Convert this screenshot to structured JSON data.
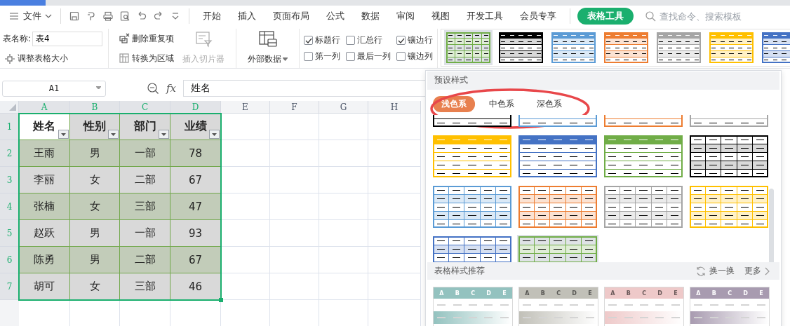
{
  "menu": {
    "file": "文件",
    "tabs": [
      {
        "label": "开始",
        "selected": false
      },
      {
        "label": "插入",
        "selected": false
      },
      {
        "label": "页面布局",
        "selected": false
      },
      {
        "label": "公式",
        "selected": false
      },
      {
        "label": "数据",
        "selected": false
      },
      {
        "label": "审阅",
        "selected": false
      },
      {
        "label": "视图",
        "selected": false
      },
      {
        "label": "开发工具",
        "selected": false
      },
      {
        "label": "会员专享",
        "selected": false
      },
      {
        "label": "表格工具",
        "selected": true
      }
    ],
    "search": {
      "placeholder": "查找命令、搜索模板"
    }
  },
  "ribbon": {
    "table_name": {
      "label": "表名称:",
      "value": "表4"
    },
    "resize": "调整表格大小",
    "tools": [
      {
        "label": "删除重复项",
        "disabled": false
      },
      {
        "label": "转换为区域",
        "disabled": false
      }
    ],
    "slicer": {
      "label": "插入切片器",
      "disabled": true
    },
    "external": "外部数据",
    "options": [
      {
        "label": "标题行",
        "checked": true
      },
      {
        "label": "汇总行",
        "checked": false
      },
      {
        "label": "镶边行",
        "checked": true
      },
      {
        "label": "第一列",
        "checked": false
      },
      {
        "label": "最后一列",
        "checked": false
      },
      {
        "label": "镶边列",
        "checked": false
      }
    ],
    "gallery": [
      {
        "kind": "grid",
        "color": "#70ad47",
        "selected": true
      },
      {
        "kind": "header_banded",
        "color": "#000000",
        "selected": false
      },
      {
        "kind": "header_banded",
        "color": "#5b9bd5",
        "selected": false
      },
      {
        "kind": "header_banded",
        "color": "#ed7d31",
        "selected": false
      },
      {
        "kind": "header_banded",
        "color": "#a5a5a5",
        "selected": false
      },
      {
        "kind": "header_banded",
        "color": "#ffc000",
        "selected": false
      },
      {
        "kind": "header_banded",
        "color": "#4472c4",
        "selected": false
      }
    ]
  },
  "formula_bar": {
    "cell": "A1",
    "fx_label": "fx",
    "value": "姓名"
  },
  "sheet": {
    "columns": [
      {
        "label": "A",
        "selected": true
      },
      {
        "label": "B",
        "selected": true
      },
      {
        "label": "C",
        "selected": true
      },
      {
        "label": "D",
        "selected": true
      },
      {
        "label": "E",
        "selected": false
      },
      {
        "label": "F",
        "selected": false
      },
      {
        "label": "G",
        "selected": false
      },
      {
        "label": "H",
        "selected": false
      }
    ],
    "header": {
      "number": "1",
      "cells": [
        {
          "text": "姓名",
          "active": true
        },
        {
          "text": "性别",
          "active": false
        },
        {
          "text": "部门",
          "active": false
        },
        {
          "text": "业绩",
          "active": false
        }
      ]
    },
    "rows": [
      {
        "number": "2",
        "cells": [
          "王雨",
          "男",
          "一部",
          "78"
        ]
      },
      {
        "number": "3",
        "cells": [
          "李丽",
          "女",
          "二部",
          "67"
        ]
      },
      {
        "number": "4",
        "cells": [
          "张楠",
          "女",
          "三部",
          "47"
        ]
      },
      {
        "number": "5",
        "cells": [
          "赵跃",
          "男",
          "一部",
          "93"
        ]
      },
      {
        "number": "6",
        "cells": [
          "陈勇",
          "男",
          "二部",
          "67"
        ]
      },
      {
        "number": "7",
        "cells": [
          "胡可",
          "女",
          "三部",
          "46"
        ]
      }
    ]
  },
  "panel": {
    "title": "预设样式",
    "categories": [
      {
        "label": "浅色系",
        "selected": true
      },
      {
        "label": "中色系",
        "selected": false
      },
      {
        "label": "深色系",
        "selected": false
      }
    ],
    "presets": [
      {
        "kind": "header",
        "color": "#000000",
        "selected": false
      },
      {
        "kind": "header",
        "color": "#5b9bd5",
        "selected": false
      },
      {
        "kind": "header",
        "color": "#ed7d31",
        "selected": false
      },
      {
        "kind": "header",
        "color": "#a5a5a5",
        "selected": false
      },
      {
        "kind": "header",
        "color": "#ffc000",
        "selected": false
      },
      {
        "kind": "header",
        "color": "#4472c4",
        "selected": false
      },
      {
        "kind": "header",
        "color": "#70ad47",
        "selected": false
      },
      {
        "kind": "grid",
        "color": "#000000",
        "selected": false
      },
      {
        "kind": "grid",
        "color": "#5b9bd5",
        "selected": false
      },
      {
        "kind": "grid",
        "color": "#ed7d31",
        "selected": false
      },
      {
        "kind": "grid",
        "color": "#a5a5a5",
        "selected": false
      },
      {
        "kind": "grid",
        "color": "#ffc000",
        "selected": false
      },
      {
        "kind": "grid",
        "color": "#4472c4",
        "selected": false
      },
      {
        "kind": "grid",
        "color": "#70ad47",
        "selected": true
      }
    ],
    "recommend": {
      "title": "表格样式推荐",
      "refresh": "换一换",
      "more": "更多",
      "items": [
        {
          "color": "#93c2bf",
          "columns": [
            "A",
            "B",
            "C",
            "D",
            "E"
          ]
        },
        {
          "color": "#c1c0b8",
          "columns": [
            "A",
            "B",
            "C",
            "D",
            "E"
          ]
        },
        {
          "color": "#eec9c9",
          "columns": [
            "A",
            "B",
            "C",
            "D",
            "E"
          ]
        },
        {
          "color": "#a89bb0",
          "columns": [
            "A",
            "B",
            "C",
            "D",
            "E"
          ]
        }
      ]
    }
  }
}
